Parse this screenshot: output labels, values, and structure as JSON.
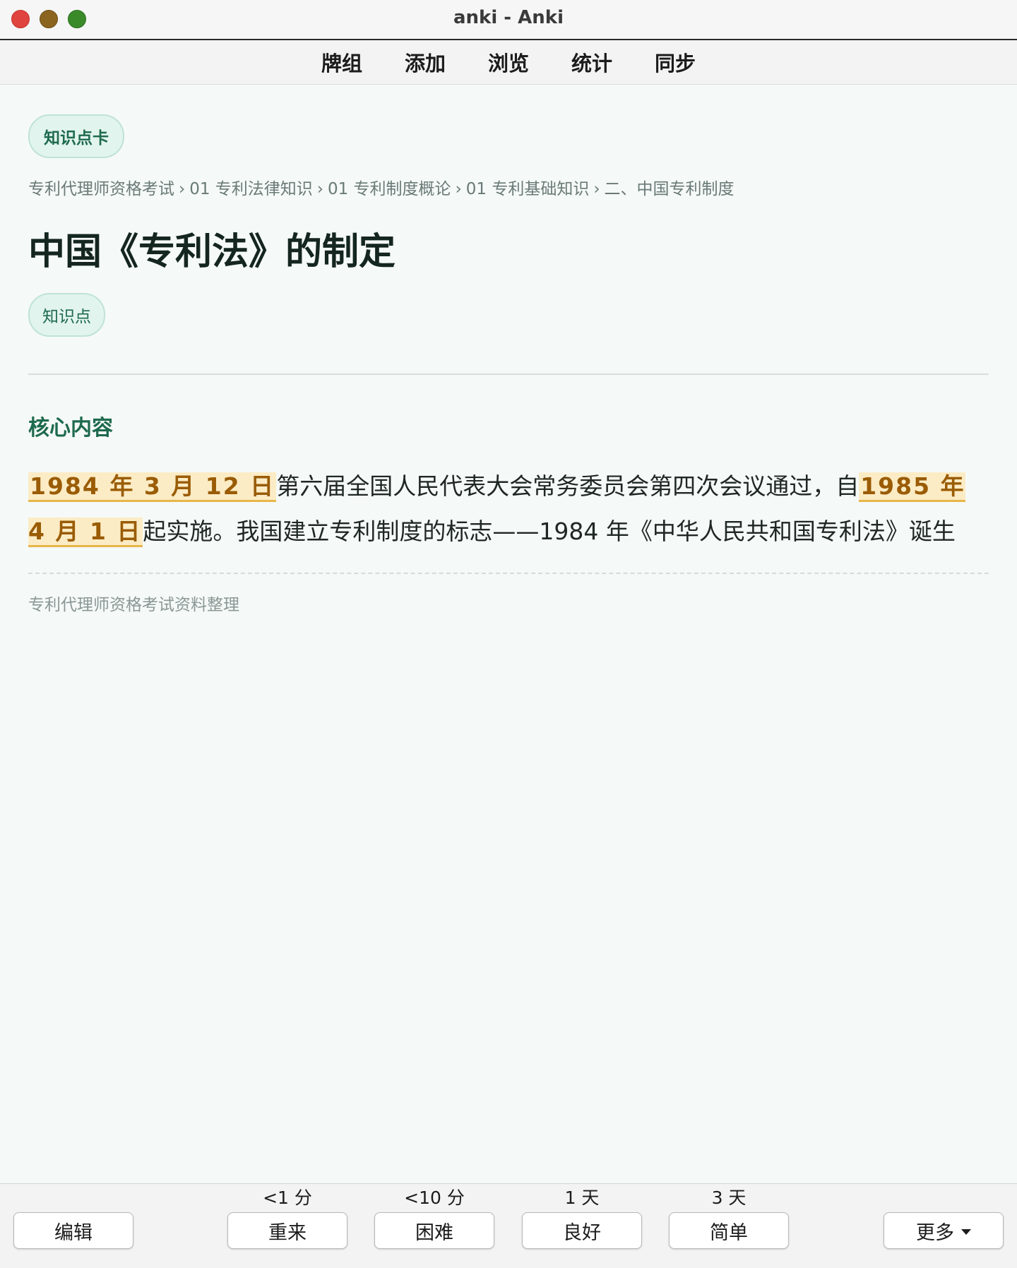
{
  "window": {
    "title": "anki - Anki"
  },
  "toolbar": {
    "items": [
      "牌组",
      "添加",
      "浏览",
      "统计",
      "同步"
    ]
  },
  "card": {
    "type_chip": "知识点卡",
    "breadcrumb": [
      "专利代理师资格考试",
      "01 专利法律知识",
      "01 专利制度概论",
      "01 专利基础知识",
      "二、中国专利制度"
    ],
    "breadcrumb_sep": "›",
    "title": "中国《专利法》的制定",
    "tag": "知识点",
    "section_heading": "核心内容",
    "body": {
      "hl1": "1984 年 3 月 12 日",
      "text1": "第六届全国人民代表大会常务委员会第四次会议通过，自",
      "hl2": "1985 年 4 月 1 日",
      "text2": "起实施。我国建立专利制度的标志——1984 年《中华人民共和国专利法》诞生"
    },
    "footer_note": "专利代理师资格考试资料整理"
  },
  "bottom": {
    "edit": "编辑",
    "answers": [
      {
        "interval": "<1 分",
        "label": "重来"
      },
      {
        "interval": "<10 分",
        "label": "困难"
      },
      {
        "interval": "1 天",
        "label": "良好"
      },
      {
        "interval": "3 天",
        "label": "简单"
      }
    ],
    "more": "更多"
  }
}
